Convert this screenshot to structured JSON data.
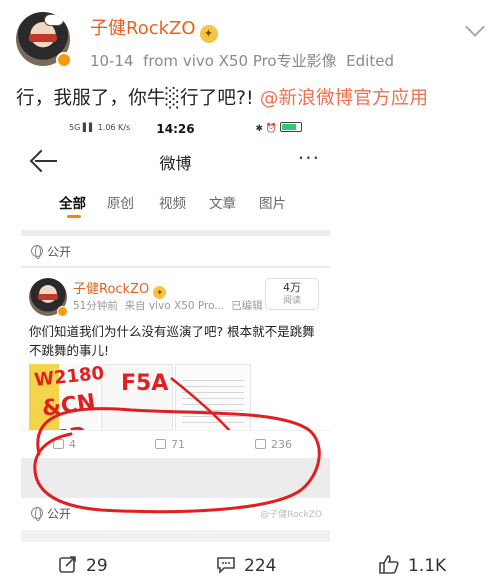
{
  "author": {
    "name": "子健RockZO",
    "date": "10-14",
    "source": "from vivo X50 Pro专业影像",
    "edited": "Edited"
  },
  "post": {
    "text": "行，我服了，你牛░行了吧?! ",
    "link": "@新浪微博官方应用"
  },
  "screenshot": {
    "statusbar": {
      "left": "5G ▌▌ 1.06 K/s",
      "time": "14:26"
    },
    "navbar": {
      "title": "微博",
      "more": "···"
    },
    "tabs": [
      "全部",
      "原创",
      "视频",
      "文章",
      "图片"
    ],
    "visibility_label": "公开",
    "inner_post": {
      "name": "子健RockZO",
      "time": "51分钟前",
      "source": "来自 vivo X50 Pro...",
      "edited": "已编辑",
      "read_count": "4万",
      "read_unit": "阅读",
      "text": "你们知道我们为什么没有巡演了吧? 根本就不是跳舞不跳舞的事儿!",
      "scribble_text_1": "W2180",
      "scribble_text_2": "F5A",
      "scribble_text_3": "&CN",
      "scribble_text_4": "USD",
      "actions": {
        "shares": "4",
        "comments": "71",
        "likes": "236"
      }
    },
    "bottom_visibility_label": "公开",
    "watermark": "@子健RockZO"
  },
  "actions": {
    "shares": "29",
    "comments": "224",
    "likes": "1.1K"
  },
  "colors": {
    "author_orange": "#e8611d",
    "link": "#eb7350",
    "tab_accent": "#ff8200",
    "scribble_red": "#e02020"
  }
}
